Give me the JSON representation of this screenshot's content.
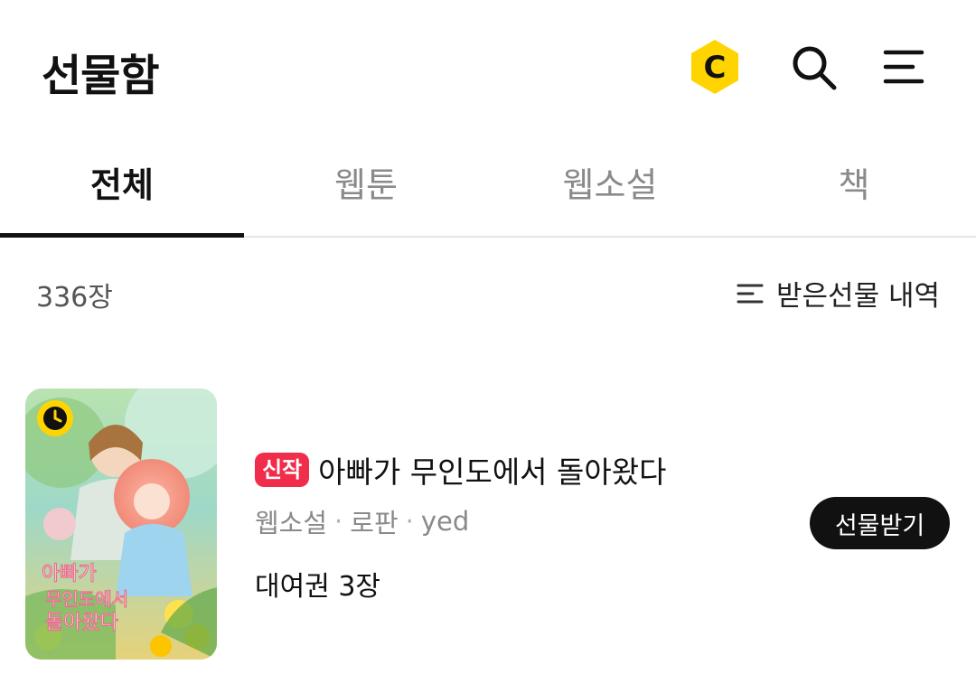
{
  "header": {
    "title": "선물함",
    "icons": [
      "coin-icon",
      "search-icon",
      "menu-icon"
    ],
    "coin_letter": "C",
    "accent_color": "#FFD400"
  },
  "tabs": [
    {
      "label": "전체",
      "active": true
    },
    {
      "label": "웹툰",
      "active": false
    },
    {
      "label": "웹소설",
      "active": false
    },
    {
      "label": "책",
      "active": false
    }
  ],
  "subbar": {
    "count": "336장",
    "history_label": "받은선물 내역",
    "history_icon": "filter-list-icon"
  },
  "items": [
    {
      "badge": "신작",
      "badge_color": "#F02D4B",
      "title": "아빠가 무인도에서 돌아왔다",
      "category": "웹소설",
      "genre": "로판",
      "author": "yed",
      "separator": "·",
      "ticket": "대여권 3장",
      "action_label": "선물받기",
      "cover_badge_icon": "clock-icon"
    }
  ]
}
